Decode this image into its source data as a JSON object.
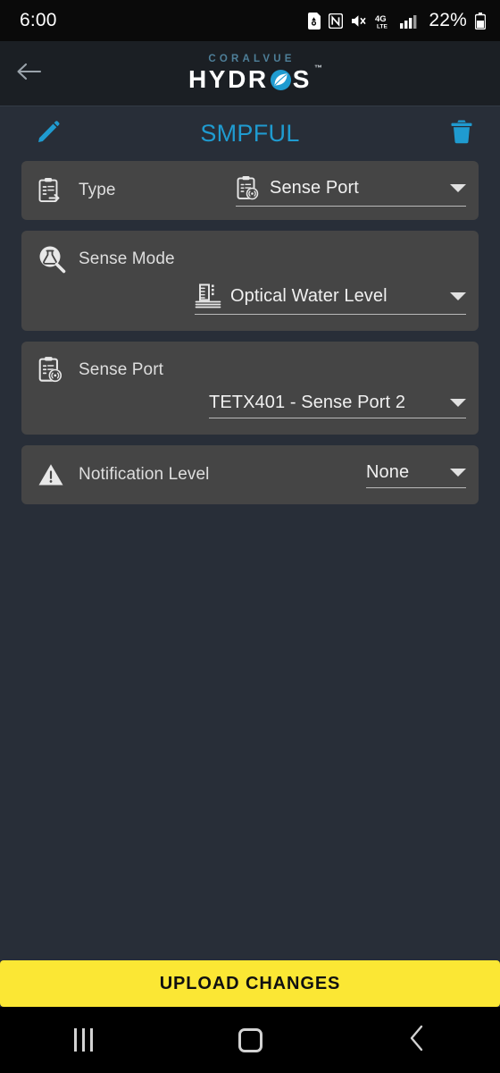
{
  "status_bar": {
    "time": "6:00",
    "battery_percent": "22%",
    "icons": [
      "sd-card-icon",
      "nfc-icon",
      "mute-icon",
      "4g-lte-icon",
      "signal-bars-icon",
      "battery-icon"
    ]
  },
  "app_bar": {
    "back_icon": "arrow-left-icon",
    "brand_top": "CORALVUE",
    "brand_left": "HYDR",
    "brand_right": "S",
    "brand_tm": "™"
  },
  "title_bar": {
    "edit_icon": "pencil-icon",
    "title": "SMPFUL",
    "delete_icon": "trash-icon",
    "title_color": "#1f9bd0"
  },
  "fields": [
    {
      "name": "type",
      "icon": "clipboard-arrow-icon",
      "label": "Type",
      "value": "Sense Port",
      "value_icon": "clipboard-signal-icon",
      "layout": "inline"
    },
    {
      "name": "sense-mode",
      "icon": "flask-magnifier-icon",
      "label": "Sense Mode",
      "value": "Optical Water Level",
      "value_icon": "water-level-gauge-icon",
      "layout": "stacked"
    },
    {
      "name": "sense-port",
      "icon": "clipboard-signal-icon",
      "label": "Sense Port",
      "value": "TETX401 - Sense Port 2",
      "value_icon": null,
      "layout": "stacked"
    },
    {
      "name": "notification-level",
      "icon": "warning-triangle-icon",
      "label": "Notification Level",
      "value": "None",
      "value_icon": null,
      "layout": "inline"
    }
  ],
  "footer": {
    "upload_label": "UPLOAD CHANGES",
    "upload_color": "#fbe734"
  },
  "nav_bar": {
    "recents_icon": "recents-icon",
    "home_icon": "home-icon",
    "back_icon": "back-chevron-icon"
  }
}
